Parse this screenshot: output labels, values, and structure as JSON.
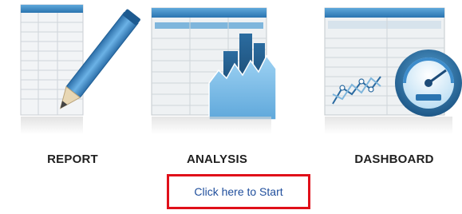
{
  "tiles": [
    {
      "id": "report",
      "label": "REPORT",
      "icon": "report-pencil-icon"
    },
    {
      "id": "analysis",
      "label": "ANALYSIS",
      "icon": "analysis-chart-icon"
    },
    {
      "id": "dashboard",
      "label": "DASHBOARD",
      "icon": "dashboard-gauge-icon"
    }
  ],
  "start": {
    "label": "Click here to Start"
  },
  "colors": {
    "accent_blue": "#2f7fb8",
    "highlight_red": "#e0101a",
    "link_blue": "#1f4e9c",
    "label_text": "#1f1f1f"
  }
}
